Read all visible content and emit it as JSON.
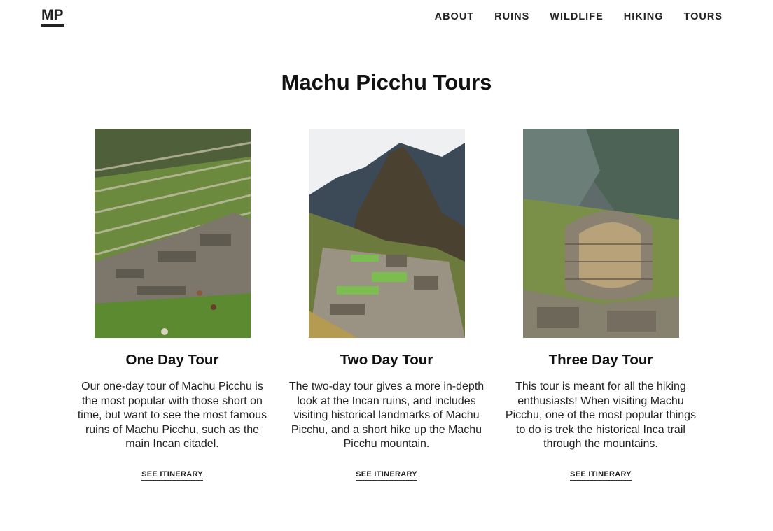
{
  "header": {
    "logo": "MP",
    "nav": [
      "ABOUT",
      "RUINS",
      "WILDLIFE",
      "HIKING",
      "TOURS"
    ]
  },
  "main": {
    "title": "Machu Picchu Tours",
    "tours": [
      {
        "title": "One Day Tour",
        "description": "Our one-day tour of Machu Picchu is the most popular with those short on time, but want to see the most famous ruins of Machu Picchu, such as the main Incan citadel.",
        "cta": "SEE ITINERARY"
      },
      {
        "title": "Two Day Tour",
        "description": "The two-day tour gives a more in-depth look at the Incan ruins, and includes visiting historical landmarks of Machu Picchu, and a short hike up the Machu Picchu mountain.",
        "cta": "SEE ITINERARY"
      },
      {
        "title": "Three Day Tour",
        "description": "This tour is meant for all the hiking enthusiasts! When visiting Machu Picchu, one of the most popular things to do is trek the historical Inca trail through the mountains.",
        "cta": "SEE ITINERARY"
      }
    ]
  },
  "colors": {
    "text": "#111111",
    "background": "#ffffff",
    "grass": "#6f9a3a",
    "stone": "#8a8276",
    "mountain": "#3f4a2e",
    "sky": "#eef0f2"
  }
}
